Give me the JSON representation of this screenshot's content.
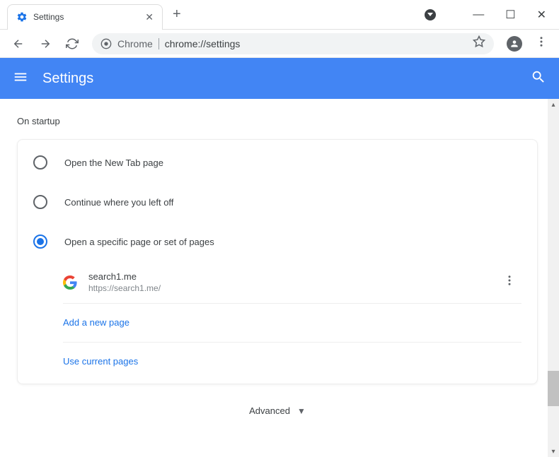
{
  "tab": {
    "title": "Settings"
  },
  "address": {
    "prefix": "Chrome",
    "url": "chrome://settings"
  },
  "header": {
    "title": "Settings"
  },
  "section": {
    "title": "On startup"
  },
  "options": [
    {
      "label": "Open the New Tab page",
      "selected": false
    },
    {
      "label": "Continue where you left off",
      "selected": false
    },
    {
      "label": "Open a specific page or set of pages",
      "selected": true
    }
  ],
  "pages": [
    {
      "name": "search1.me",
      "url": "https://search1.me/"
    }
  ],
  "links": {
    "add_page": "Add a new page",
    "use_current": "Use current pages"
  },
  "advanced": {
    "label": "Advanced"
  }
}
